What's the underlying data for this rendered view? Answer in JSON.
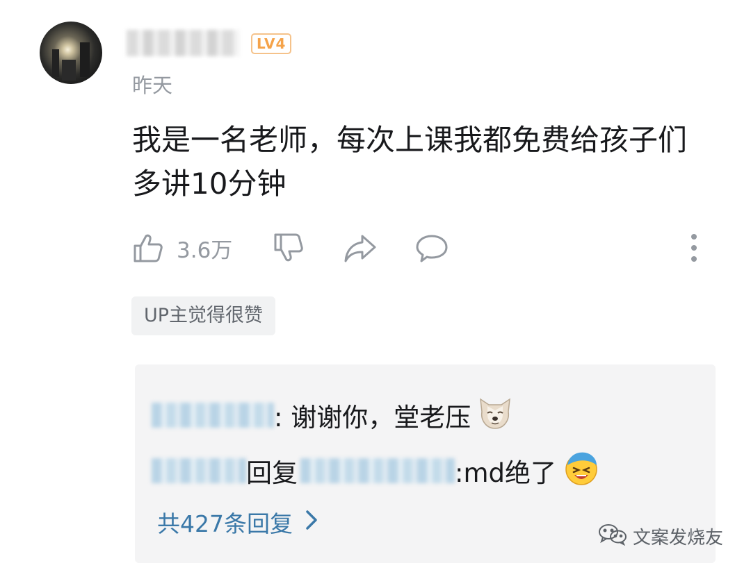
{
  "comment": {
    "level_badge": "LV4",
    "date": "昨天",
    "text": "我是一名老师，每次上课我都免费给孩子们多讲10分钟",
    "like_count": "3.6万",
    "up_tag": "UP主觉得很赞"
  },
  "replies": {
    "line1": {
      "text": ": 谢谢你，堂老压",
      "emoji": "dog-emoji"
    },
    "line2": {
      "reply_word": "回复",
      "text": ":md绝了",
      "emoji": "laughing-emoji"
    },
    "total": "共427条回复"
  },
  "watermark": {
    "text": "文案发烧友"
  },
  "colors": {
    "link": "#3a78a8",
    "muted": "#9499a0",
    "badge": "#f5a34a"
  }
}
